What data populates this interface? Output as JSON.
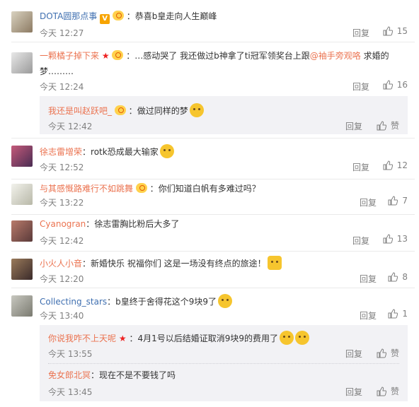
{
  "ui": {
    "reply_label": "回复",
    "like_label": "赞"
  },
  "comments": [
    {
      "user": "DOTA圆那点事",
      "text": "恭喜b皇走向人生巅峰",
      "time": "今天 12:27",
      "likes": "15"
    },
    {
      "user": "一颗橘子掉下来",
      "text": "…感动哭了 我还做过b神拿了ti冠军领奖台上跟",
      "mention": "@袖手旁观咯",
      "text2": " 求婚的",
      "text3": "梦………",
      "time": "今天 12:24",
      "likes": "16",
      "sub": {
        "user": "我还是叫赵跃吧_",
        "text": "做过同样的梦",
        "time": "今天 12:42"
      }
    },
    {
      "user": "徐志雷增荣",
      "text": "rotk恐成最大输家",
      "time": "今天 12:52",
      "likes": "12"
    },
    {
      "user": "与其感慨路难行不如跳舞",
      "text": "你们知道白帆有多难过吗？",
      "time": "今天 13:22",
      "likes": "7"
    },
    {
      "user": "Cyanogran",
      "text": "徐志雷胸比粉后大多了",
      "time": "今天 12:42",
      "likes": "13"
    },
    {
      "user": "小火人小音",
      "text": "新婚快乐 祝福你们 这是一场没有终点的旅途！",
      "time": "今天 12:20",
      "likes": "8"
    },
    {
      "user": "Collecting_stars",
      "text": "b皇终于舍得花这个9块9了",
      "time": "今天 13:40",
      "likes": "1",
      "subs": [
        {
          "user": "你说我咋不上天呢",
          "text": "4月1号以后结婚证取消9块9的费用了",
          "time": "今天 13:55"
        },
        {
          "user": "免女郎北冥",
          "text": "现在不是不要钱了吗",
          "time": "今天 13:45"
        }
      ]
    }
  ]
}
